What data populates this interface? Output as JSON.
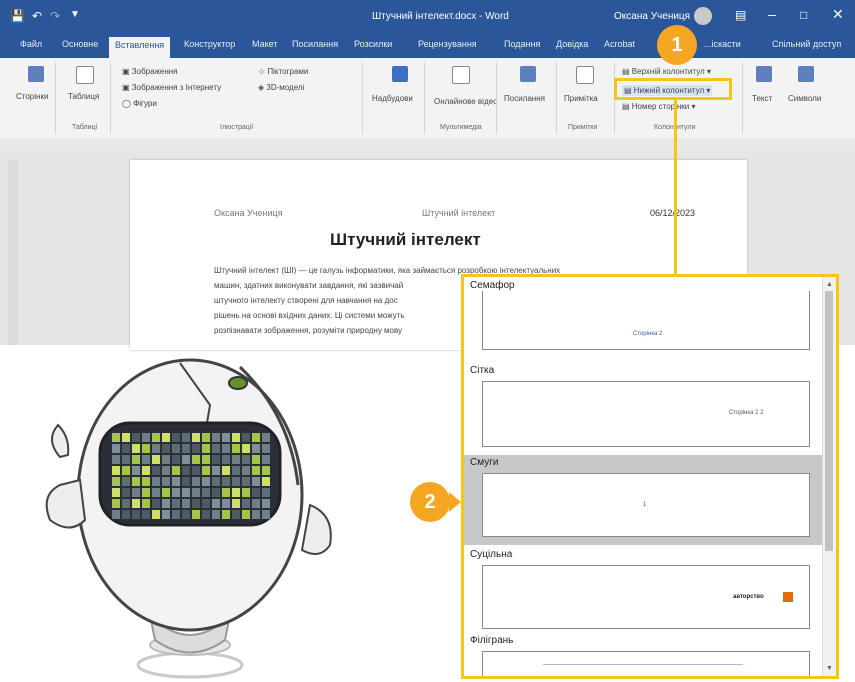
{
  "titlebar": {
    "document_title": "Штучний інтелект.docx - Word",
    "user": "Оксана Учениця"
  },
  "tabs": [
    "Файл",
    "Основне",
    "Вставлення",
    "Конструктор",
    "Макет",
    "Посилання",
    "Розсилки",
    "Рецензування",
    "Подання",
    "Довідка",
    "Acrobat"
  ],
  "tab_right": "Спільний доступ",
  "tab_partial": "...іскасти",
  "ribbon": {
    "pages": "Сторінки",
    "table": "Таблиця",
    "pictures": "Зображення",
    "online_pictures": "Зображення з Інтернету",
    "shapes": "Фігури",
    "icons": "Піктограми",
    "models_3d": "3D-моделі",
    "addins": "Надбудови",
    "online_video": "Онлайнове відео",
    "links": "Посилання",
    "comment": "Примітка",
    "header": "Верхній колонтитул",
    "footer": "Нижній колонтитул",
    "page_number": "Номер сторінки",
    "text": "Текст",
    "symbols": "Символи",
    "groups": {
      "tables": "Таблиці",
      "illustrations": "Ілюстрації",
      "media": "Мультимедіа",
      "comments": "Примітки",
      "header_footer": "Колонтитули"
    }
  },
  "document": {
    "header_left": "Оксана Учениця",
    "header_center": "Штучний інтелект",
    "header_right": "06/12/2023",
    "title": "Штучний інтелект",
    "body_lines": [
      "Штучний інтелект (ШІ) — це галузь інформатики, яка займається розробкою інтелектуальних",
      "машин, здатних виконувати завдання, які зазвичай",
      "штучного інтелекту створені для навчання на дос",
      "рішень на основі вхідних даних. Ці системи можуть",
      "розпізнавати зображення, розуміти природну мову"
    ]
  },
  "callouts": {
    "one": "1",
    "two": "2"
  },
  "gallery": {
    "items": [
      {
        "name": "Семафор",
        "thumb_text": "Сторінка 2"
      },
      {
        "name": "Сітка",
        "thumb_text": "Сторінка 2 2"
      },
      {
        "name": "Смуги",
        "thumb_text": "1"
      },
      {
        "name": "Суцільна",
        "thumb_text": "авторство"
      },
      {
        "name": "Філігрань",
        "thumb_text": ""
      }
    ],
    "selected_index": 2
  },
  "colors": {
    "word_blue": "#2b579a",
    "callout_orange": "#f5a623",
    "highlight_yellow": "#f5c518"
  }
}
